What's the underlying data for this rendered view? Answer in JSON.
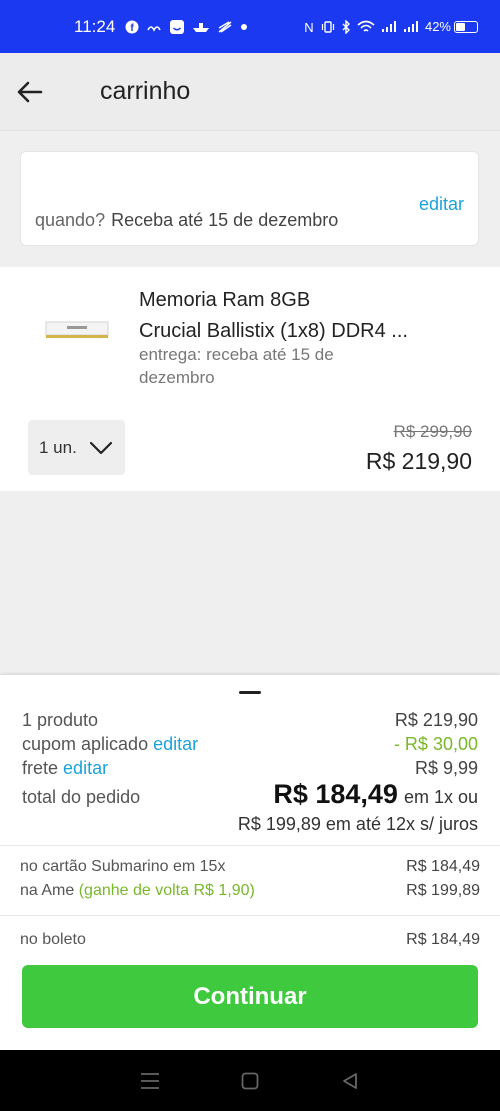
{
  "status_bar": {
    "time": "11:24",
    "battery": "42%",
    "left_icons": [
      "facebook-icon",
      "whatsapp-like-icon",
      "smile-icon",
      "boat-icon",
      "flag-icon",
      "dot-icon"
    ],
    "right_icons": [
      "nfc-icon",
      "vibrate-icon",
      "bluetooth-icon",
      "wifi-icon",
      "signal-icon",
      "signal-icon",
      "battery-icon"
    ]
  },
  "header": {
    "back_icon": "arrow-left-icon",
    "title": "carrinho"
  },
  "delivery": {
    "edit_label": "editar",
    "when_label": "quando?",
    "when_value": "Receba até 15 de dezembro"
  },
  "product": {
    "name_line1": "Memoria Ram 8GB",
    "name_line2": "Crucial Ballistix (1x8) DDR4 ...",
    "eta_line1": "entrega: receba até 15 de",
    "eta_line2": "dezembro",
    "quantity": "1 un.",
    "old_price": "R$ 299,90",
    "price": "R$ 219,90"
  },
  "summary": {
    "items_label": "1 produto",
    "items_value": "R$ 219,90",
    "coupon_label": "cupom aplicado",
    "coupon_edit": "editar",
    "coupon_value": "- R$ 30,00",
    "shipping_label": "frete",
    "shipping_edit": "editar",
    "shipping_value": "R$ 9,99",
    "total_label": "total do pedido",
    "total_value": "R$ 184,49",
    "total_suffix": "em 1x ou",
    "installments": "R$ 199,89 em até 12x s/ juros",
    "card_label": "no cartão Submarino em 15x",
    "card_value": "R$ 184,49",
    "ame_label": "na Ame",
    "ame_cashback": "(ganhe de volta R$ 1,90)",
    "ame_value": "R$ 199,89",
    "boleto_label": "no boleto",
    "boleto_value": "R$ 184,49",
    "continue_label": "Continuar"
  },
  "colors": {
    "status_bar": "#1a39f0",
    "link": "#1aa3d9",
    "discount": "#78b82a",
    "cta": "#3ec93e"
  }
}
